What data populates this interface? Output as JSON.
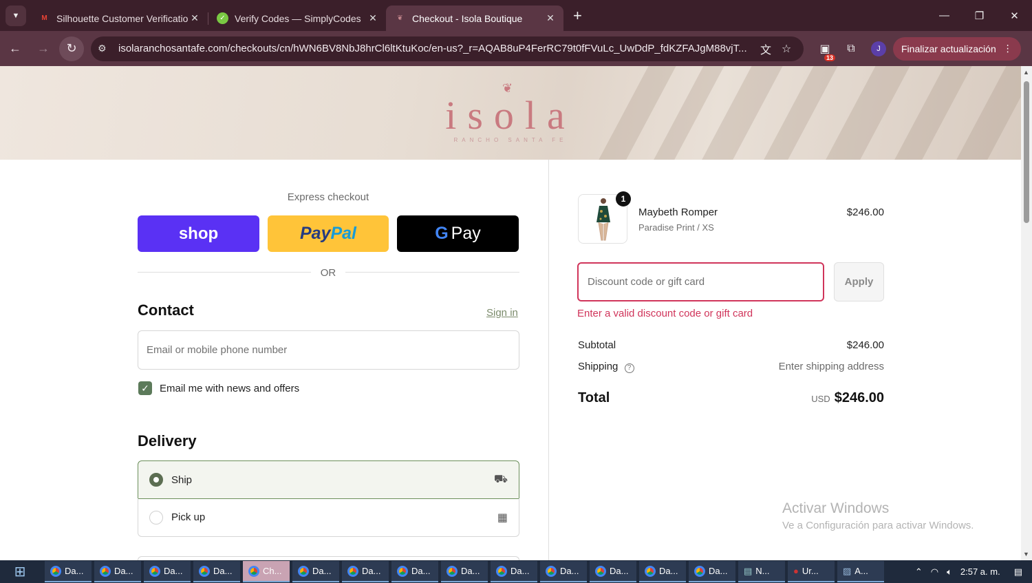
{
  "browser": {
    "tabs": [
      {
        "title": "Silhouette Customer Verificatio",
        "favicon": "gmail-icon"
      },
      {
        "title": "Verify Codes — SimplyCodes",
        "favicon": "simplycodes-icon"
      },
      {
        "title": "Checkout - Isola Boutique",
        "favicon": "isola-icon",
        "active": true
      }
    ],
    "url": "isolaranchosantafe.com/checkouts/cn/hWN6BV8NbJ8hrCl6ltKtuKoc/en-us?_r=AQAB8uP4FerRC79t0fFVuLc_UwDdP_fdKZFAJgM88vjT...",
    "extensions_badge": "13",
    "profile_initial": "J",
    "update_label": "Finalizar actualización"
  },
  "hero": {
    "logo": "isola",
    "logo_sub": "RANCHO SANTA FE"
  },
  "express": {
    "title": "Express checkout",
    "shop_label": "shop",
    "paypal_pay": "Pay",
    "paypal_pal": "Pal",
    "gpay_g": "G",
    "gpay_label": "Pay",
    "or": "OR"
  },
  "contact": {
    "heading": "Contact",
    "signin": "Sign in",
    "email_placeholder": "Email or mobile phone number",
    "newsletter_label": "Email me with news and offers"
  },
  "delivery": {
    "heading": "Delivery",
    "options": [
      {
        "label": "Ship",
        "selected": true,
        "icon": "truck-icon"
      },
      {
        "label": "Pick up",
        "selected": false,
        "icon": "store-icon"
      }
    ]
  },
  "summary": {
    "item": {
      "name": "Maybeth Romper",
      "variant": "Paradise Print / XS",
      "price": "$246.00",
      "qty": "1"
    },
    "discount_placeholder": "Discount code or gift card",
    "apply_label": "Apply",
    "error": "Enter a valid discount code or gift card",
    "subtotal_label": "Subtotal",
    "subtotal_value": "$246.00",
    "shipping_label": "Shipping",
    "shipping_value": "Enter shipping address",
    "total_label": "Total",
    "currency": "USD",
    "total_value": "$246.00"
  },
  "watermark": {
    "line1": "Activar Windows",
    "line2": "Ve a Configuración para activar Windows."
  },
  "taskbar": {
    "items": [
      "Da...",
      "Da...",
      "Da...",
      "Da...",
      "Ch...",
      "Da...",
      "Da...",
      "Da...",
      "Da...",
      "Da...",
      "Da...",
      "Da...",
      "Da...",
      "Da...",
      "N...",
      "Ur...",
      "A..."
    ],
    "time": "2:57 a. m."
  },
  "colors": {
    "accent": "#5c7a5a",
    "error": "#d0345a",
    "shop": "#5a31f4",
    "paypal": "#ffc439"
  }
}
